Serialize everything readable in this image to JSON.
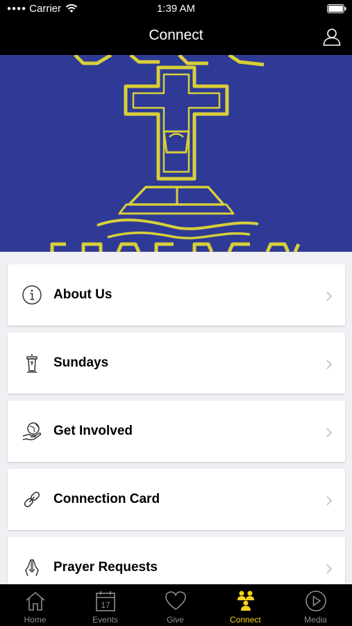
{
  "status": {
    "carrier": "Carrier",
    "time": "1:39 AM"
  },
  "header": {
    "title": "Connect"
  },
  "items": [
    {
      "label": "About Us",
      "icon": "info-icon"
    },
    {
      "label": "Sundays",
      "icon": "pulpit-icon"
    },
    {
      "label": "Get Involved",
      "icon": "globe-hand-icon"
    },
    {
      "label": "Connection Card",
      "icon": "link-icon"
    },
    {
      "label": "Prayer Requests",
      "icon": "praying-hands-icon"
    }
  ],
  "tabs": [
    {
      "label": "Home",
      "icon": "home-icon"
    },
    {
      "label": "Events",
      "icon": "calendar-icon",
      "date": "17"
    },
    {
      "label": "Give",
      "icon": "heart-icon"
    },
    {
      "label": "Connect",
      "icon": "people-icon",
      "active": true
    },
    {
      "label": "Media",
      "icon": "play-icon"
    }
  ],
  "colors": {
    "accent": "#f6d21b",
    "hero_bg": "#2e3a95",
    "logo": "#d8cf3a"
  }
}
